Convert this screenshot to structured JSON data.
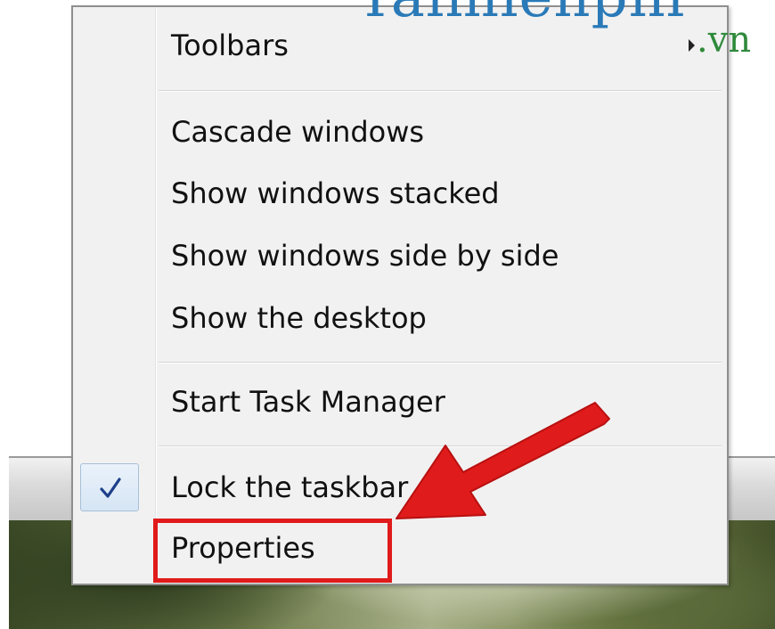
{
  "watermark": {
    "text": "Taimienphi",
    "suffix": ".vn"
  },
  "menu": {
    "items": [
      {
        "label": "Toolbars",
        "submenu": true
      },
      {
        "label": "Cascade windows"
      },
      {
        "label": "Show windows stacked"
      },
      {
        "label": "Show windows side by side"
      },
      {
        "label": "Show the desktop"
      },
      {
        "label": "Start Task Manager"
      },
      {
        "label": "Lock the taskbar",
        "checked": true
      },
      {
        "label": "Properties",
        "highlighted": true
      }
    ]
  },
  "icons": {
    "submenu": "chevron-right-icon",
    "check": "checkmark-icon",
    "annotation": "red-arrow-icon"
  },
  "colors": {
    "menu_bg": "#f1f1f1",
    "highlight_border": "#e01b1b",
    "arrow": "#e01b1b",
    "checkmark": "#1d3f8a",
    "watermark_blue": "#2a7ab8",
    "watermark_green": "#2f8a3c"
  }
}
